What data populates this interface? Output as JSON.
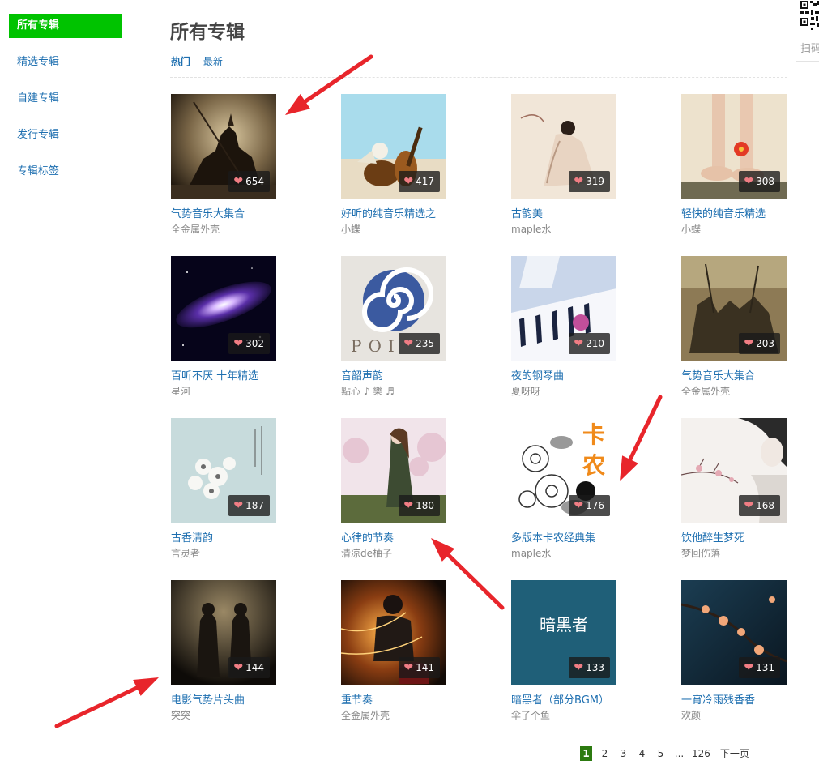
{
  "sidebar": {
    "items": [
      {
        "label": "所有专辑",
        "active": true
      },
      {
        "label": "精选专辑",
        "active": false
      },
      {
        "label": "自建专辑",
        "active": false
      },
      {
        "label": "发行专辑",
        "active": false
      },
      {
        "label": "专辑标签",
        "active": false
      }
    ]
  },
  "header": {
    "title": "所有专辑",
    "sort_tabs": [
      {
        "label": "热门",
        "active": true
      },
      {
        "label": "最新",
        "active": false
      }
    ]
  },
  "qr": {
    "label": "扫码"
  },
  "albums": [
    {
      "title": "气势音乐大集合",
      "author": "全金属外壳",
      "likes": "654",
      "art": "knight"
    },
    {
      "title": "好听的纯音乐精选之",
      "author": "小蝶",
      "likes": "417",
      "art": "guitar"
    },
    {
      "title": "古韵美",
      "author": "maple水",
      "likes": "319",
      "art": "lady"
    },
    {
      "title": "轻快的纯音乐精选",
      "author": "小蝶",
      "likes": "308",
      "art": "feet"
    },
    {
      "title": "百听不厌 十年精选",
      "author": "星河",
      "likes": "302",
      "art": "galaxy"
    },
    {
      "title": "音韶声韵",
      "author": "點心 ♪ 樂 ♬",
      "likes": "235",
      "art": "spiral"
    },
    {
      "title": "夜的钢琴曲",
      "author": "夏呀呀",
      "likes": "210",
      "art": "piano"
    },
    {
      "title": "气势音乐大集合",
      "author": "全金属外壳",
      "likes": "203",
      "art": "battle"
    },
    {
      "title": "古香清韵",
      "author": "言灵者",
      "likes": "187",
      "art": "flowers"
    },
    {
      "title": "心律的节奏",
      "author": "清凉de柚子",
      "likes": "180",
      "art": "girl"
    },
    {
      "title": "多版本卡农经典集",
      "author": "maple水",
      "likes": "176",
      "art": "canon"
    },
    {
      "title": "饮他醉生梦死",
      "author": "梦回伤落",
      "likes": "168",
      "art": "sketch"
    },
    {
      "title": "电影气势片头曲",
      "author": "突突",
      "likes": "144",
      "art": "statues"
    },
    {
      "title": "重节奏",
      "author": "全金属外壳",
      "likes": "141",
      "art": "drummer"
    },
    {
      "title": "暗黑者（部分BGM）",
      "author": "伞了个鱼",
      "likes": "133",
      "art": "dark",
      "cover_text": "暗黑者"
    },
    {
      "title": "一宵冷雨残香香",
      "author": "欢颜",
      "likes": "131",
      "art": "blossom"
    }
  ],
  "cover_art_text": {
    "spiral_letters": "POI",
    "canon_chars": [
      "卡",
      "农"
    ]
  },
  "pagination": {
    "pages": [
      "1",
      "2",
      "3",
      "4",
      "5",
      "...",
      "126"
    ],
    "current": "1",
    "next_label": "下一页"
  },
  "colors": {
    "accent_green": "#00c300",
    "link_blue": "#1e6fb0",
    "page_current": "#2c7a10",
    "annotation_red": "#e8252b"
  }
}
